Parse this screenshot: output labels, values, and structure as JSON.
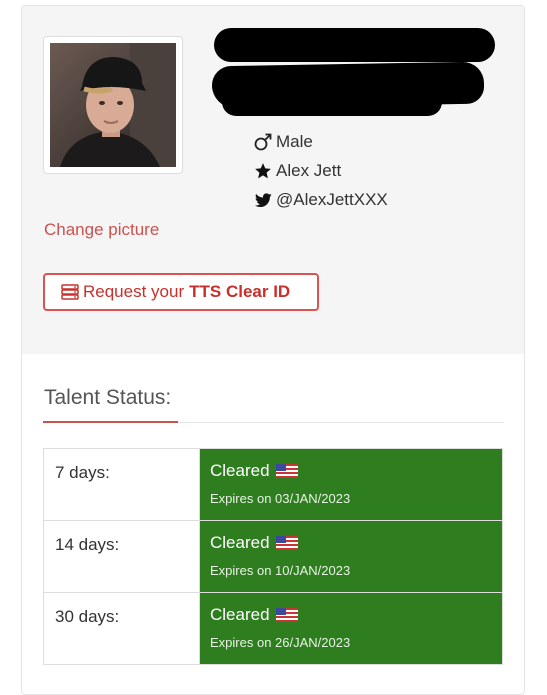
{
  "profile": {
    "gender": "Male",
    "name": "Alex Jett",
    "twitter": "@AlexJettXXX",
    "change_picture": "Change picture",
    "tts_button": {
      "prefix": "Request your",
      "bold": "TTS Clear ID"
    }
  },
  "talent_status": {
    "title": "Talent Status:",
    "rows": [
      {
        "days": "7 days:",
        "status": "Cleared",
        "expires": "Expires on 03/JAN/2023"
      },
      {
        "days": "14 days:",
        "status": "Cleared",
        "expires": "Expires on 10/JAN/2023"
      },
      {
        "days": "30 days:",
        "status": "Cleared",
        "expires": "Expires on 26/JAN/2023"
      }
    ]
  },
  "colors": {
    "accent": "#c9534f",
    "cleared": "#2e7d1f",
    "panel": "#f5f5f5"
  },
  "icons": [
    "male-icon",
    "star-icon",
    "twitter-icon",
    "server-icon",
    "us-flag-icon"
  ]
}
